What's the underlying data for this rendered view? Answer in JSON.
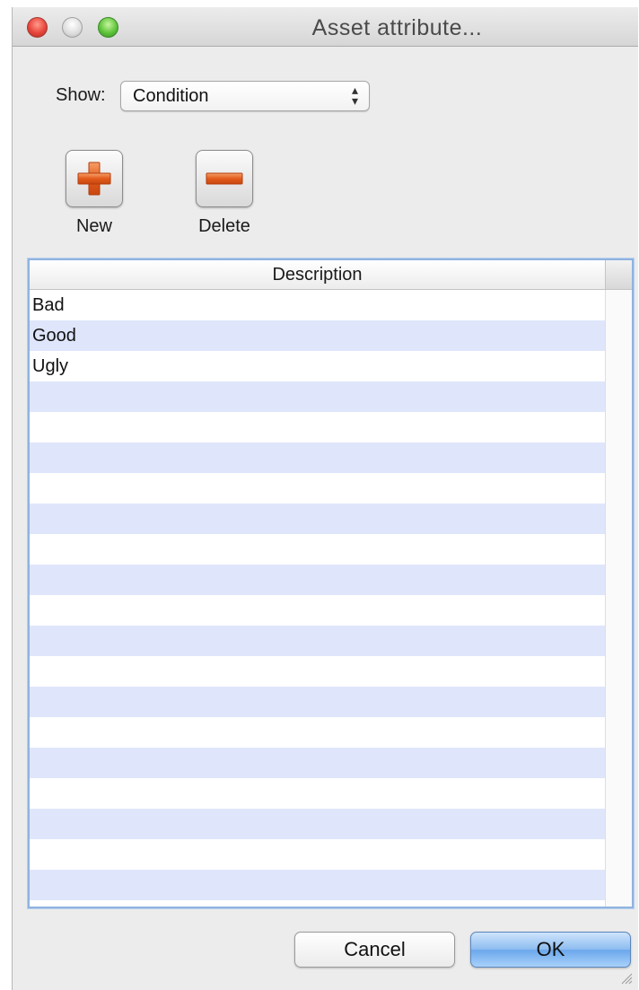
{
  "window": {
    "title": "Asset attribute..."
  },
  "filter": {
    "label": "Show:",
    "selected": "Condition"
  },
  "toolbar": {
    "new_label": "New",
    "delete_label": "Delete",
    "new_icon": "plus-icon",
    "delete_icon": "minus-icon"
  },
  "table": {
    "column_header": "Description",
    "rows": [
      "Bad",
      "Good",
      "Ugly",
      "",
      "",
      "",
      "",
      "",
      "",
      "",
      "",
      "",
      "",
      "",
      "",
      "",
      "",
      "",
      "",
      "",
      ""
    ]
  },
  "footer": {
    "cancel_label": "Cancel",
    "ok_label": "OK"
  },
  "colors": {
    "accent": "#e05a1e",
    "row_stripe": "#dfe6fb",
    "default_button": "#8cbcf0"
  }
}
